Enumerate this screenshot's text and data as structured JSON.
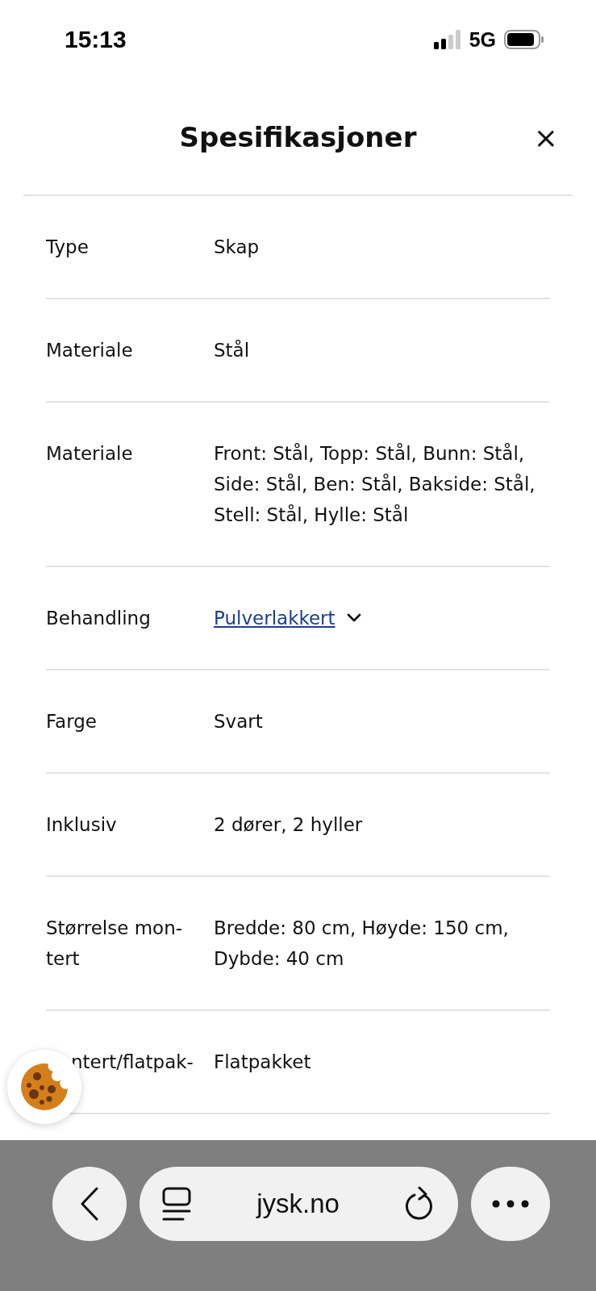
{
  "status_bar": {
    "time": "15:13",
    "network": "5G"
  },
  "sheet": {
    "title": "Spesifikasjoner",
    "close": "×"
  },
  "rows": [
    {
      "label": "Type",
      "value": "Skap",
      "kind": "text"
    },
    {
      "label": "Materiale",
      "value": "Stål",
      "kind": "text"
    },
    {
      "label": "Materiale",
      "value": "Front: Stål, Topp: Stål, Bunn: Stål, Side: Stål, Ben: Stål, Bakside: Stål, Stell: Stål, Hylle: Stål",
      "kind": "text"
    },
    {
      "label": "Behandling",
      "value": "Pulverlakkert",
      "kind": "link",
      "expanded": false
    },
    {
      "label": "Farge",
      "value": "Svart",
      "kind": "text"
    },
    {
      "label": "Inklusiv",
      "value": "2 dører, 2 hyller",
      "kind": "text"
    },
    {
      "label": "Størrelse mon-tert",
      "value": "Bredde: 80 cm, Høyde: 150 cm, Dybde: 40 cm",
      "kind": "text"
    },
    {
      "label": "ntert/flatpak-",
      "value": "Flatpakket",
      "kind": "covered"
    }
  ],
  "browser_bar": {
    "url": "jysk.no"
  }
}
